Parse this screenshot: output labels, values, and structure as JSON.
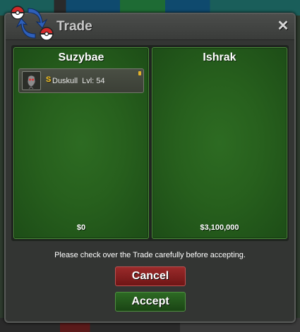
{
  "window": {
    "title": "Trade",
    "close_symbol": "✕",
    "icon": "trade-pokeballs-icon"
  },
  "trade": {
    "left": {
      "player_name": "Suzybae",
      "money": "$0",
      "items": [
        {
          "badge": "S",
          "name": "Duskull",
          "level": "Lvl: 54",
          "icon": "duskull-sprite-icon"
        }
      ]
    },
    "right": {
      "player_name": "Ishrak",
      "money": "$3,100,000",
      "items": []
    }
  },
  "notice": "Please check over the Trade carefully before accepting.",
  "buttons": {
    "cancel": "Cancel",
    "accept": "Accept"
  },
  "colors": {
    "panel_green": "#27601d",
    "cancel_red": "#8a2020",
    "accept_green": "#24561c",
    "badge_gold": "#f2c329"
  }
}
